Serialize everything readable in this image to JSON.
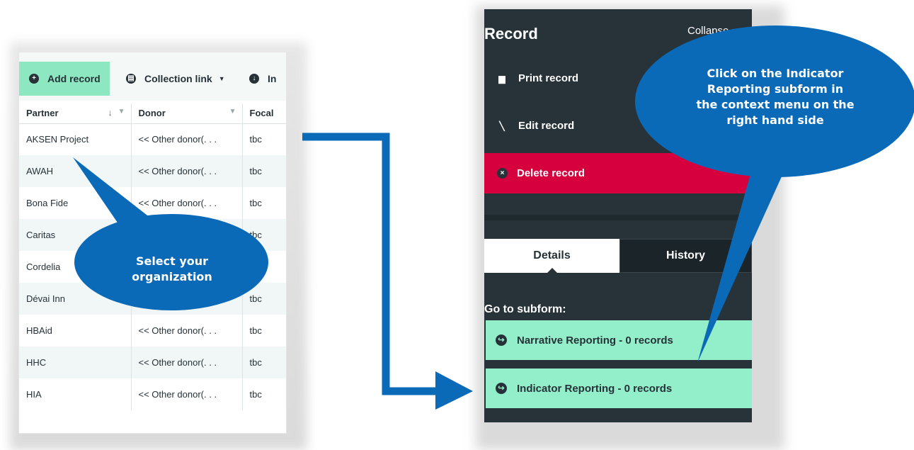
{
  "toolbar": {
    "add_record": "Add record",
    "collection_link": "Collection link",
    "import_partial": "In"
  },
  "table": {
    "columns": [
      "Partner",
      "Donor",
      "Focal"
    ],
    "rows": [
      [
        "AKSEN Project",
        "<< Other donor(. . .",
        "tbc"
      ],
      [
        "AWAH",
        "<< Other donor(. . .",
        "tbc"
      ],
      [
        "Bona Fide",
        "<< Other donor(. . .",
        "tbc"
      ],
      [
        "Caritas",
        "",
        "tbc"
      ],
      [
        "Cordelia",
        "",
        ""
      ],
      [
        "Dévai Inn",
        "",
        "tbc"
      ],
      [
        "HBAid",
        "<< Other donor(. . .",
        "tbc"
      ],
      [
        "HHC",
        "<< Other donor(. . .",
        "tbc"
      ],
      [
        "HIA",
        "<< Other donor(. . .",
        "tbc"
      ]
    ]
  },
  "callouts": {
    "left_line1": "Select your",
    "left_line2": "organization",
    "right_line1": "Click on the Indicator",
    "right_line2": "Reporting subform in",
    "right_line3": "the context menu on the",
    "right_line4": "right hand side"
  },
  "record_panel": {
    "title": "Record",
    "collapse": "Collapse",
    "print": "Print record",
    "edit": "Edit record",
    "delete": "Delete record",
    "tab_details": "Details",
    "tab_history": "History",
    "goto_label": "Go to subform:",
    "sub_narrative": "Narrative Reporting - 0 records",
    "sub_indicator": "Indicator Reporting - 0 records"
  },
  "colors": {
    "callout_blue": "#0a6ab8",
    "add_green": "#8de8c1",
    "delete_red": "#d7003f",
    "panel_dark": "#273338"
  }
}
